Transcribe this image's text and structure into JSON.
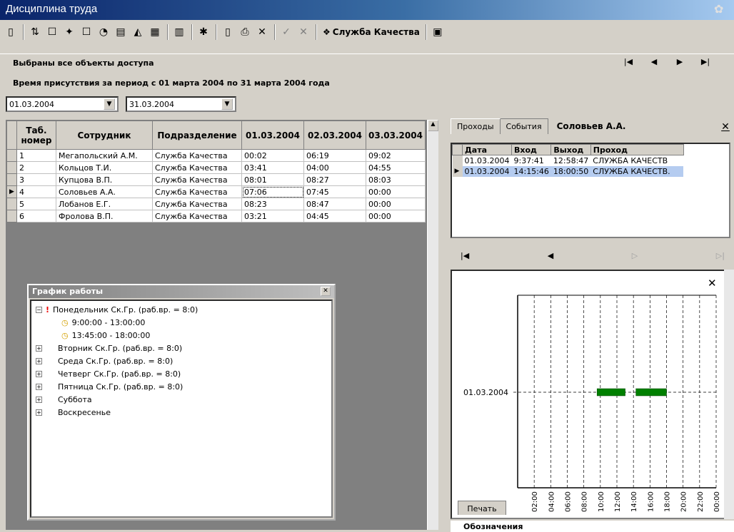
{
  "window": {
    "title": "Дисциплина труда"
  },
  "toolbar": {
    "quality_label": "Служба Качества"
  },
  "status": {
    "selected": "Выбраны все объекты доступа",
    "period": "Время присутствия за период с 01 марта 2004  по 31 марта 2004 года"
  },
  "filters": {
    "date_from": "01.03.2004",
    "date_to": "31.03.2004"
  },
  "grid": {
    "headers": [
      "Таб. номер",
      "Сотрудник",
      "Подразделение",
      "01.03.2004",
      "02.03.2004",
      "03.03.2004"
    ],
    "rows": [
      {
        "num": "1",
        "name": "Мегапольский А.М.",
        "dept": "Служба Качества",
        "d1": "00:02",
        "d2": "06:19",
        "d3": "09:02"
      },
      {
        "num": "2",
        "name": "Кольцов Т.И.",
        "dept": "Служба Качества",
        "d1": "03:41",
        "d2": "04:00",
        "d3": "04:55"
      },
      {
        "num": "3",
        "name": "Купцова В.П.",
        "dept": "Служба Качества",
        "d1": "08:01",
        "d2": "08:27",
        "d3": "08:03"
      },
      {
        "num": "4",
        "name": "Соловьев А.А.",
        "dept": "Служба Качества",
        "d1": "07:06",
        "d2": "07:45",
        "d3": "00:00"
      },
      {
        "num": "5",
        "name": "Лобанов Е.Г.",
        "dept": "Служба Качества",
        "d1": "08:23",
        "d2": "08:47",
        "d3": "00:00"
      },
      {
        "num": "6",
        "name": "Фролова В.П.",
        "dept": "Служба Качества",
        "d1": "03:21",
        "d2": "04:45",
        "d3": "00:00"
      }
    ]
  },
  "schedule": {
    "title": "График работы",
    "monday": "Понедельник Ск.Гр. (раб.вр. = 8:0)",
    "slot1": "9:00:00 - 13:00:00",
    "slot2": "13:45:00 - 18:00:00",
    "days": [
      "Вторник Ск.Гр. (раб.вр. = 8:0)",
      "Среда Ск.Гр. (раб.вр. = 8:0)",
      "Четверг Ск.Гр. (раб.вр. = 8:0)",
      "Пятница Ск.Гр. (раб.вр. = 8:0)",
      "Суббота",
      "Воскресенье"
    ]
  },
  "rightpanel": {
    "tab1": "Проходы",
    "tab2": "События",
    "employee": "Соловьев А.А.",
    "headers": [
      "Дата",
      "Вход",
      "Выход",
      "Проход"
    ],
    "rows": [
      {
        "date": "01.03.2004",
        "in": "9:37:41",
        "out": "12:58:47",
        "pass": "СЛУЖБА КАЧЕСТВ"
      },
      {
        "date": "01.03.2004",
        "in": "14:15:46",
        "out": "18:00:50",
        "pass": "СЛУЖБА КАЧЕСТВ."
      }
    ],
    "print_label": "Печать",
    "legend_label": "Обозначения"
  },
  "chart_data": {
    "type": "bar",
    "ylabel_date": "01.03.2004",
    "x_ticks": [
      "02:00",
      "04:00",
      "06:00",
      "08:00",
      "10:00",
      "12:00",
      "14:00",
      "16:00",
      "18:00",
      "20:00",
      "22:00",
      "00:00"
    ],
    "xlim": [
      0,
      24
    ],
    "intervals": [
      [
        9.6,
        13.0
      ],
      [
        14.3,
        18.0
      ]
    ],
    "color": "#008000"
  }
}
